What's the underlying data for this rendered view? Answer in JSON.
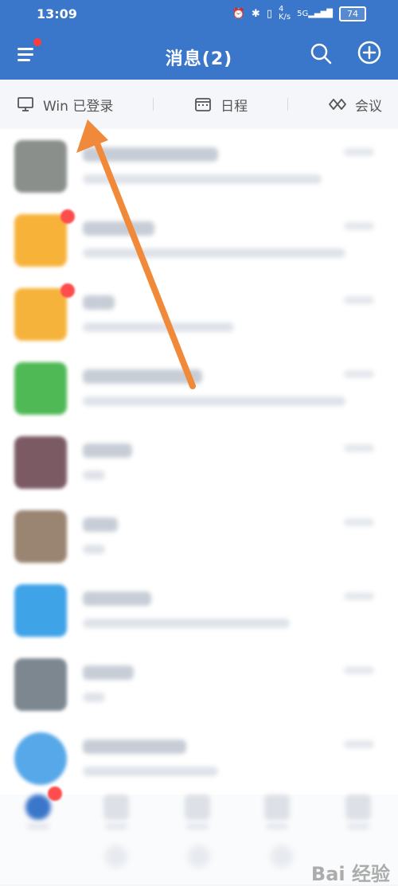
{
  "status_bar": {
    "time": "13:09",
    "speed_value": "4",
    "speed_unit": "K/s",
    "network": "5G",
    "battery": "74"
  },
  "header": {
    "title": "消息(2)"
  },
  "quick_bar": {
    "items": [
      {
        "label": "Win 已登录",
        "icon": "monitor-icon"
      },
      {
        "label": "日程",
        "icon": "calendar-icon"
      },
      {
        "label": "会议",
        "icon": "meeting-icon"
      }
    ]
  },
  "messages": [
    {
      "avatar_color": "#8a8f8c",
      "badge": false
    },
    {
      "avatar_color": "#f7b23a",
      "badge": true
    },
    {
      "avatar_color": "#f6b33b",
      "badge": true
    },
    {
      "avatar_color": "#4fb955",
      "badge": false
    },
    {
      "avatar_color": "#7b5a64",
      "badge": false
    },
    {
      "avatar_color": "#9a8572",
      "badge": false
    },
    {
      "avatar_color": "#3fa3e8",
      "badge": false
    },
    {
      "avatar_color": "#7c8790",
      "badge": false
    },
    {
      "avatar_color": "#56a8e8",
      "badge": false
    }
  ],
  "annotation": {
    "arrow_color": "#f08a3a"
  },
  "watermark": {
    "text": "Bai 经验"
  }
}
